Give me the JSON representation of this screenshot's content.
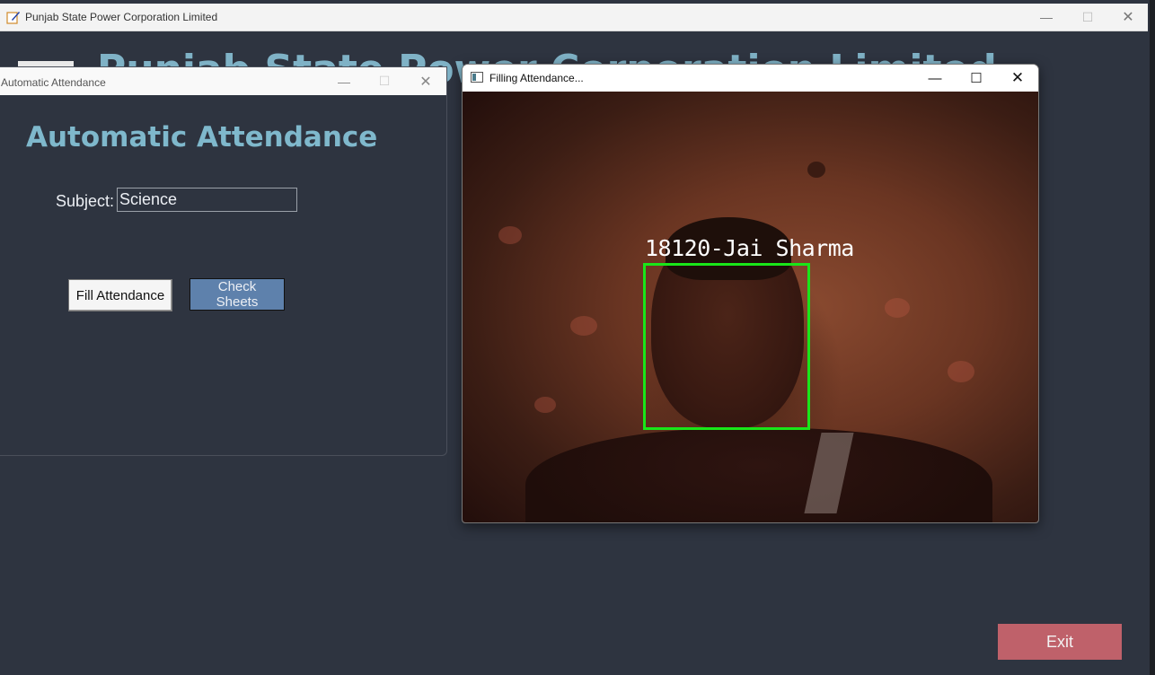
{
  "main_window": {
    "title": "Punjab State Power Corporation Limited",
    "heading": "Punjab State Power Corporation Limited",
    "controls": {
      "minimize": "—",
      "maximize": "☐",
      "close": "✕"
    },
    "exit_label": "Exit"
  },
  "attendance_window": {
    "title": "Automatic Attendance",
    "heading": "Automatic Attendance",
    "subject_label": "Subject:",
    "subject_value": "Science",
    "fill_button": "Fill Attendance",
    "check_button": "Check Sheets",
    "controls": {
      "minimize": "—",
      "maximize": "☐",
      "close": "✕"
    }
  },
  "camera_window": {
    "title": "Filling Attendance...",
    "face_label": "18120-Jai Sharma",
    "controls": {
      "minimize": "—",
      "maximize": "☐",
      "close": "✕"
    }
  },
  "colors": {
    "background": "#2e3440",
    "heading": "#7fb8cc",
    "exit_button": "#bf616a",
    "check_button": "#5e81ac",
    "face_box": "#19e619"
  }
}
